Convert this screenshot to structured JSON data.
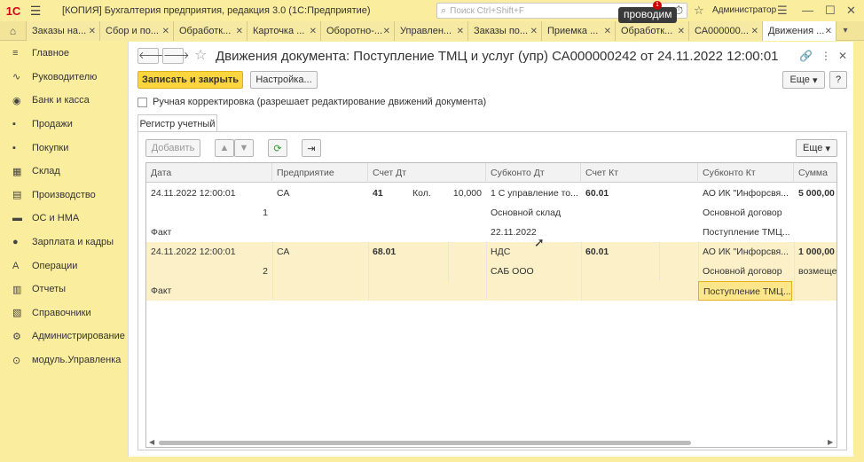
{
  "titlebar": {
    "logo": "1С",
    "app_title": "[КОПИЯ] Бухгалтерия предприятия, редакция 3.0  (1С:Предприятие)",
    "search_placeholder": "Поиск Ctrl+Shift+F",
    "overlay_label": "проводим",
    "notif_count": "1",
    "user": "Администратор"
  },
  "tabs": [
    {
      "label": "Заказы на..."
    },
    {
      "label": "Сбор и по..."
    },
    {
      "label": "Обработк..."
    },
    {
      "label": "Карточка ..."
    },
    {
      "label": "Оборотно-..."
    },
    {
      "label": "Управлен..."
    },
    {
      "label": "Заказы по..."
    },
    {
      "label": "Приемка ..."
    },
    {
      "label": "Обработк..."
    },
    {
      "label": "СА000000..."
    },
    {
      "label": "Движения ..."
    }
  ],
  "sidebar": {
    "items": [
      {
        "label": "Главное",
        "icon": "≡"
      },
      {
        "label": "Руководителю",
        "icon": "∿"
      },
      {
        "label": "Банк и касса",
        "icon": "◉"
      },
      {
        "label": "Продажи",
        "icon": "▪"
      },
      {
        "label": "Покупки",
        "icon": "▪"
      },
      {
        "label": "Склад",
        "icon": "▦"
      },
      {
        "label": "Производство",
        "icon": "▤"
      },
      {
        "label": "ОС и НМА",
        "icon": "▬"
      },
      {
        "label": "Зарплата и кадры",
        "icon": "●"
      },
      {
        "label": "Операции",
        "icon": "A"
      },
      {
        "label": "Отчеты",
        "icon": "▥"
      },
      {
        "label": "Справочники",
        "icon": "▧"
      },
      {
        "label": "Администрирование",
        "icon": "⚙"
      },
      {
        "label": "модуль.Управленка",
        "icon": "⊙"
      }
    ]
  },
  "document": {
    "title": "Движения документа: Поступление ТМЦ и услуг (упр) СА000000242 от 24.11.2022 12:00:01",
    "save_close": "Записать и закрыть",
    "settings": "Настройка...",
    "more": "Еще",
    "help": "?",
    "manual_edit": "Ручная корректировка (разрешает редактирование движений документа)",
    "register_tab": "Регистр учетный"
  },
  "toolbar": {
    "add": "Добавить",
    "more": "Еще"
  },
  "table": {
    "columns": [
      "Дата",
      "Предприятие",
      "Счет Дт",
      "Субконто Дт",
      "Счет Кт",
      "Субконто Кт",
      "Сумма"
    ],
    "rows": [
      {
        "date": "24.11.2022 12:00:01",
        "num": "1",
        "type": "Факт",
        "company": "СА",
        "dt_account": "41",
        "qty_label": "Кол.",
        "qty": "10,000",
        "sub_dt1": "1 С управление то...",
        "sub_dt2": "Основной склад",
        "sub_dt3": "22.11.2022",
        "kt_account": "60.01",
        "sub_kt1": "АО ИК \"Инфорсвя...",
        "sub_kt2": "Основной договор",
        "sub_kt3": "Поступление ТМЦ...",
        "sum": "5 000,00",
        "sum2": ""
      },
      {
        "date": "24.11.2022 12:00:01",
        "num": "2",
        "type": "Факт",
        "company": "СА",
        "dt_account": "68.01",
        "qty_label": "",
        "qty": "",
        "sub_dt1": "НДС",
        "sub_dt2": "САБ ООО",
        "sub_dt3": "",
        "kt_account": "60.01",
        "sub_kt1": "АО ИК \"Инфорсвя...",
        "sub_kt2": "Основной договор",
        "sub_kt3": "Поступление ТМЦ...",
        "sum": "1 000,00",
        "sum2": "возмеще"
      }
    ]
  }
}
